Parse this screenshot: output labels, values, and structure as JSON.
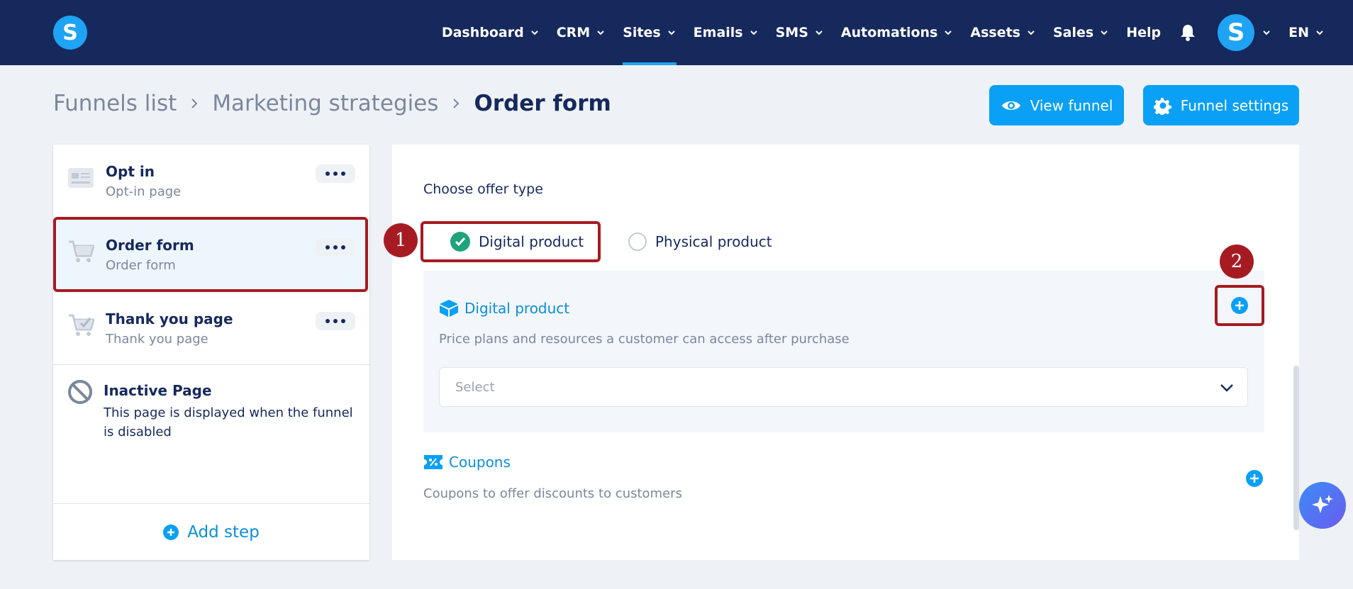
{
  "nav": {
    "logo": "S",
    "items": [
      {
        "label": "Dashboard",
        "active": false
      },
      {
        "label": "CRM",
        "active": false
      },
      {
        "label": "Sites",
        "active": true
      },
      {
        "label": "Emails",
        "active": false
      },
      {
        "label": "SMS",
        "active": false
      },
      {
        "label": "Automations",
        "active": false
      },
      {
        "label": "Assets",
        "active": false
      },
      {
        "label": "Sales",
        "active": false
      }
    ],
    "help": "Help",
    "avatar": "S",
    "language": "EN"
  },
  "breadcrumb": {
    "funnels_list": "Funnels list",
    "marketing": "Marketing strategies",
    "current": "Order form"
  },
  "header_buttons": {
    "view_funnel": "View funnel",
    "funnel_settings": "Funnel settings"
  },
  "steps": [
    {
      "title": "Opt in",
      "subtitle": "Opt-in page"
    },
    {
      "title": "Order form",
      "subtitle": "Order form",
      "selected": true
    },
    {
      "title": "Thank you page",
      "subtitle": "Thank you page"
    }
  ],
  "inactive_page": {
    "title": "Inactive Page",
    "description": "This page is displayed when the funnel is disabled"
  },
  "add_step": "Add step",
  "offer": {
    "label": "Choose offer type",
    "digital": "Digital product",
    "physical": "Physical product",
    "selected": "Digital product"
  },
  "digital_box": {
    "title": "Digital product",
    "description": "Price plans and resources a customer can access after purchase",
    "select_placeholder": "Select"
  },
  "coupons": {
    "title": "Coupons",
    "description": "Coupons to offer discounts to customers"
  },
  "annotations": [
    "1",
    "2"
  ],
  "colors": {
    "nav_bg": "#16295c",
    "accent": "#0aa0f5",
    "annotation": "#a61b22",
    "success": "#1fa37a"
  }
}
